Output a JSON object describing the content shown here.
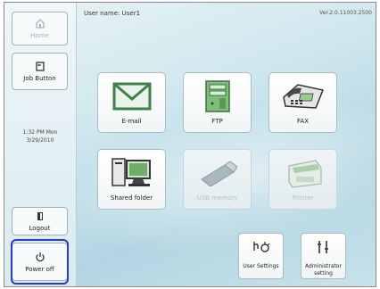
{
  "sidebar": {
    "home_label": "Home",
    "job_button_label": "Job Button",
    "clock_time": "1:32 PM Mon",
    "clock_date": "3/29/2010",
    "logout_label": "Logout",
    "power_off_label": "Power off"
  },
  "header": {
    "username": "User name: User1",
    "version": "Ver.2.0.11003.2500"
  },
  "tiles": {
    "email": "E-mail",
    "ftp": "FTP",
    "fax": "FAX",
    "shared_folder": "Shared folder",
    "usb_memory": "USB memory",
    "printer": "Printer"
  },
  "settings": {
    "user_settings": "User Settings",
    "admin_line1": "Administrator",
    "admin_line2": "setting"
  },
  "colors": {
    "highlight_ring": "#2a3cc4",
    "accent_green": "#4f8f5a"
  }
}
